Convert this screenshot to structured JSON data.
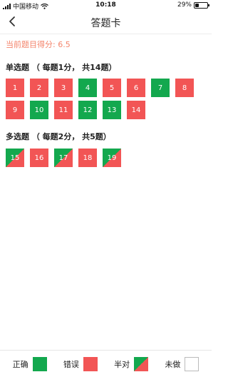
{
  "status_bar": {
    "carrier": "中国移动",
    "time": "10:18",
    "battery": "29%",
    "battery_level": 0.29
  },
  "nav": {
    "title": "答题卡",
    "back_icon": "chevron-left-icon"
  },
  "score": {
    "label": "当前题目得分:",
    "value": "6.5"
  },
  "sections": [
    {
      "title": "单选题",
      "note": "（ 每题1分， 共14题）",
      "items": [
        {
          "num": "1",
          "status": "wrong"
        },
        {
          "num": "2",
          "status": "wrong"
        },
        {
          "num": "3",
          "status": "wrong"
        },
        {
          "num": "4",
          "status": "correct"
        },
        {
          "num": "5",
          "status": "wrong"
        },
        {
          "num": "6",
          "status": "wrong"
        },
        {
          "num": "7",
          "status": "correct"
        },
        {
          "num": "8",
          "status": "wrong"
        },
        {
          "num": "9",
          "status": "wrong"
        },
        {
          "num": "10",
          "status": "correct"
        },
        {
          "num": "11",
          "status": "wrong"
        },
        {
          "num": "12",
          "status": "correct"
        },
        {
          "num": "13",
          "status": "correct"
        },
        {
          "num": "14",
          "status": "wrong"
        }
      ]
    },
    {
      "title": "多选题",
      "note": "（ 每题2分， 共5题）",
      "items": [
        {
          "num": "15",
          "status": "half"
        },
        {
          "num": "16",
          "status": "wrong"
        },
        {
          "num": "17",
          "status": "half"
        },
        {
          "num": "18",
          "status": "wrong"
        },
        {
          "num": "19",
          "status": "half"
        }
      ]
    }
  ],
  "legend": {
    "correct": "正确",
    "wrong": "错误",
    "half": "半对",
    "unanswered": "未做"
  },
  "colors": {
    "correct": "#13a84e",
    "wrong": "#f25555",
    "score_text": "#f4846b"
  }
}
